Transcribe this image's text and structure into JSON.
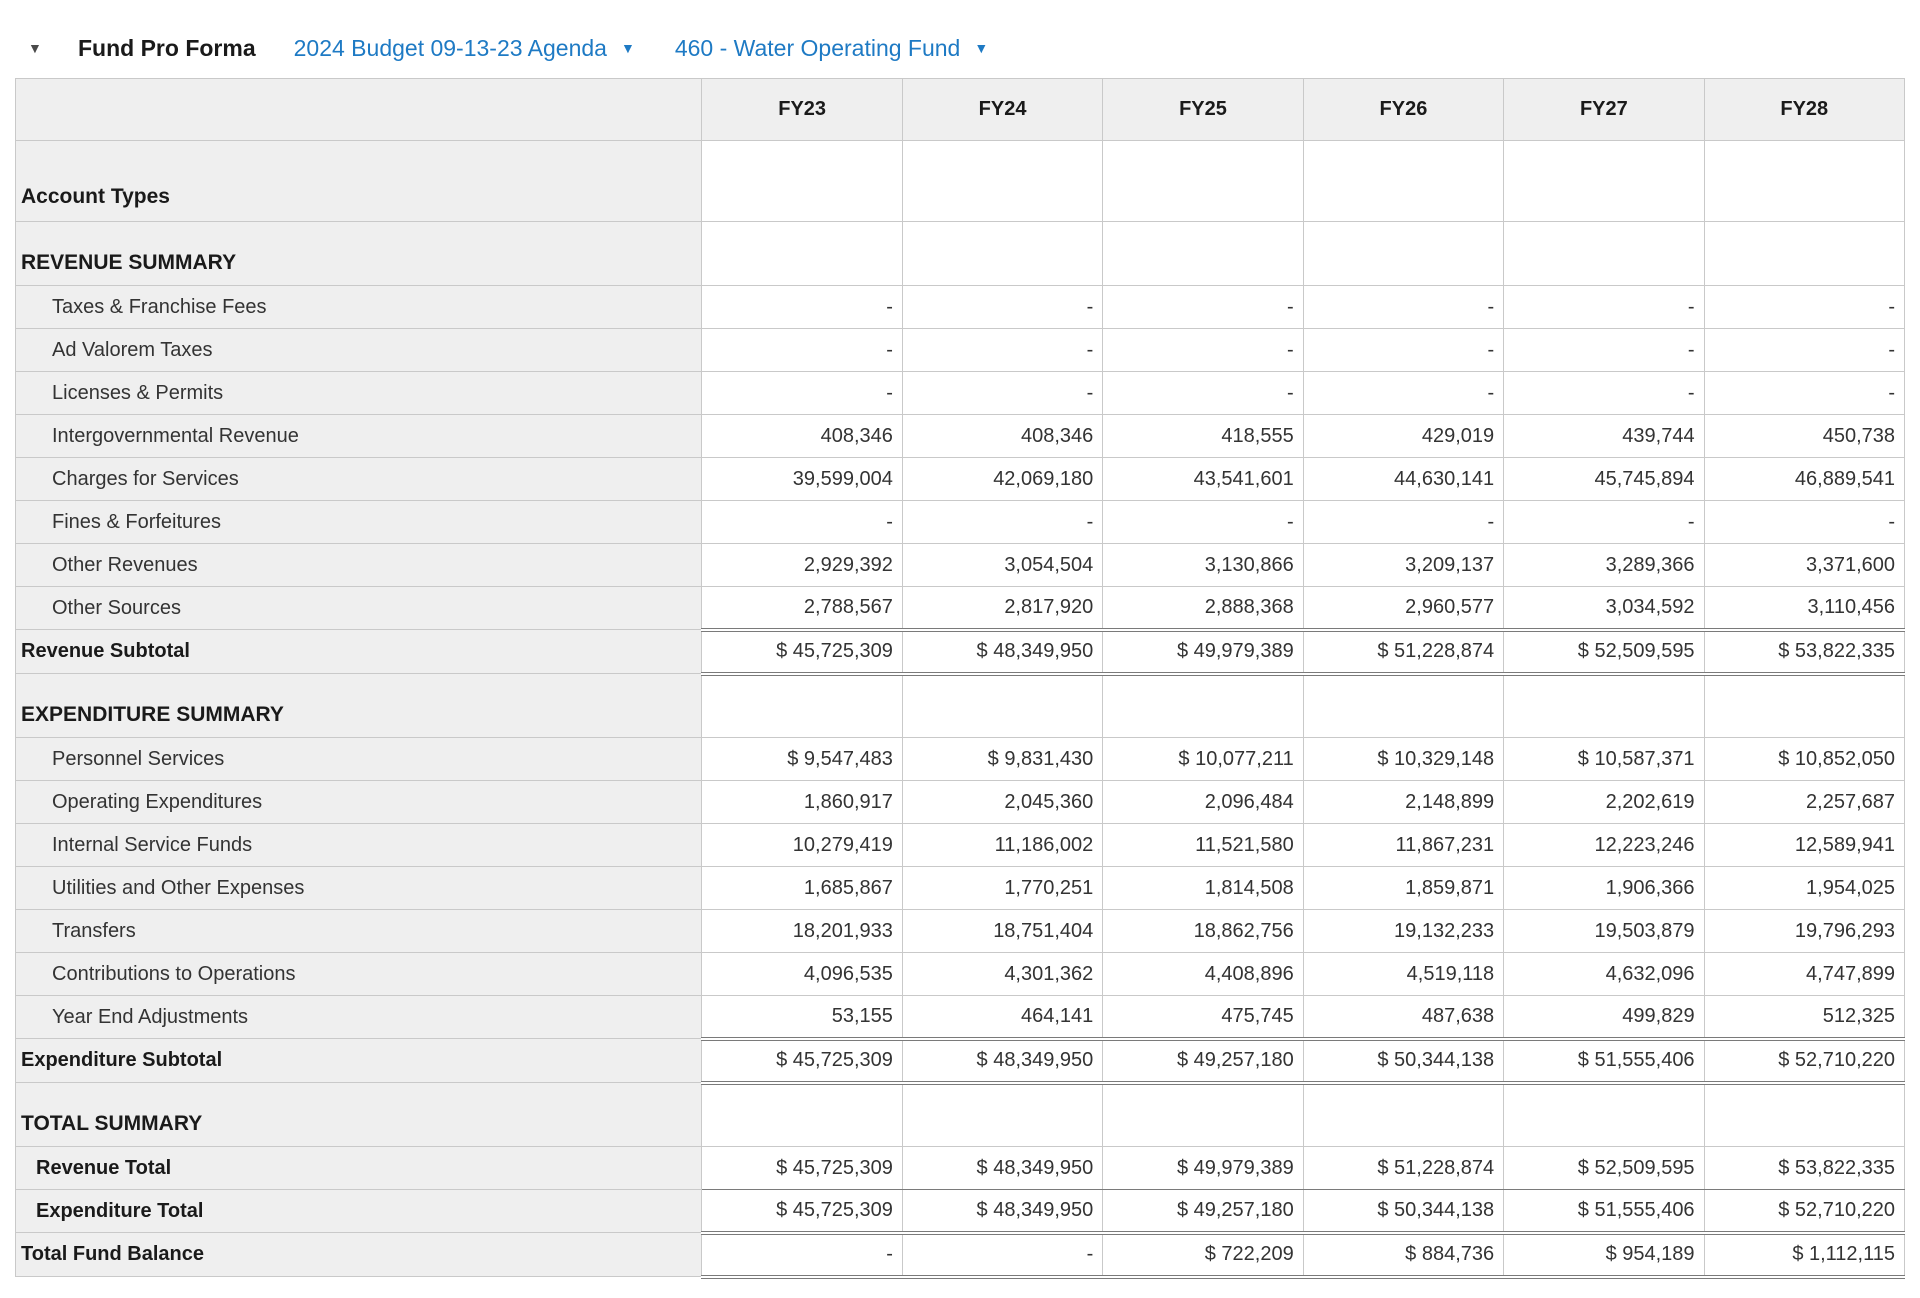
{
  "colors": {
    "link": "#1e7ac4",
    "shade": "#efefef",
    "border": "#c9c9c9",
    "rule": "#7a7a7a"
  },
  "header": {
    "title": "Fund Pro Forma",
    "budget_dropdown": "2024 Budget 09-13-23 Agenda",
    "fund_dropdown": "460 - Water Operating Fund",
    "collapse_caret": "▼",
    "dropdown_caret": "▼"
  },
  "table": {
    "columns": [
      "FY23",
      "FY24",
      "FY25",
      "FY26",
      "FY27",
      "FY28"
    ],
    "rows": [
      {
        "type": "caption",
        "label": "Account Types",
        "values": [
          "",
          "",
          "",
          "",
          "",
          ""
        ]
      },
      {
        "type": "section",
        "label": "REVENUE SUMMARY",
        "values": [
          "",
          "",
          "",
          "",
          "",
          ""
        ]
      },
      {
        "type": "item",
        "label": "Taxes & Franchise Fees",
        "values": [
          "-",
          "-",
          "-",
          "-",
          "-",
          "-"
        ]
      },
      {
        "type": "item",
        "label": "Ad Valorem Taxes",
        "values": [
          "-",
          "-",
          "-",
          "-",
          "-",
          "-"
        ]
      },
      {
        "type": "item",
        "label": "Licenses & Permits",
        "values": [
          "-",
          "-",
          "-",
          "-",
          "-",
          "-"
        ]
      },
      {
        "type": "item",
        "label": "Intergovernmental Revenue",
        "values": [
          "408,346",
          "408,346",
          "418,555",
          "429,019",
          "439,744",
          "450,738"
        ]
      },
      {
        "type": "item",
        "label": "Charges for Services",
        "values": [
          "39,599,004",
          "42,069,180",
          "43,541,601",
          "44,630,141",
          "45,745,894",
          "46,889,541"
        ]
      },
      {
        "type": "item",
        "label": "Fines & Forfeitures",
        "values": [
          "-",
          "-",
          "-",
          "-",
          "-",
          "-"
        ]
      },
      {
        "type": "item",
        "label": "Other Revenues",
        "values": [
          "2,929,392",
          "3,054,504",
          "3,130,866",
          "3,209,137",
          "3,289,366",
          "3,371,600"
        ]
      },
      {
        "type": "item",
        "label": "Other Sources",
        "values": [
          "2,788,567",
          "2,817,920",
          "2,888,368",
          "2,960,577",
          "3,034,592",
          "3,110,456"
        ]
      },
      {
        "type": "subtotal",
        "label": "Revenue Subtotal",
        "values": [
          "$ 45,725,309",
          "$ 48,349,950",
          "$ 49,979,389",
          "$ 51,228,874",
          "$ 52,509,595",
          "$ 53,822,335"
        ]
      },
      {
        "type": "section",
        "label": "EXPENDITURE SUMMARY",
        "values": [
          "",
          "",
          "",
          "",
          "",
          ""
        ]
      },
      {
        "type": "item",
        "label": "Personnel Services",
        "values": [
          "$ 9,547,483",
          "$ 9,831,430",
          "$ 10,077,211",
          "$ 10,329,148",
          "$ 10,587,371",
          "$ 10,852,050"
        ]
      },
      {
        "type": "item",
        "label": "Operating Expenditures",
        "values": [
          "1,860,917",
          "2,045,360",
          "2,096,484",
          "2,148,899",
          "2,202,619",
          "2,257,687"
        ]
      },
      {
        "type": "item",
        "label": "Internal Service Funds",
        "values": [
          "10,279,419",
          "11,186,002",
          "11,521,580",
          "11,867,231",
          "12,223,246",
          "12,589,941"
        ]
      },
      {
        "type": "item",
        "label": "Utilities and Other Expenses",
        "values": [
          "1,685,867",
          "1,770,251",
          "1,814,508",
          "1,859,871",
          "1,906,366",
          "1,954,025"
        ]
      },
      {
        "type": "item",
        "label": "Transfers",
        "values": [
          "18,201,933",
          "18,751,404",
          "18,862,756",
          "19,132,233",
          "19,503,879",
          "19,796,293"
        ]
      },
      {
        "type": "item",
        "label": "Contributions to Operations",
        "values": [
          "4,096,535",
          "4,301,362",
          "4,408,896",
          "4,519,118",
          "4,632,096",
          "4,747,899"
        ]
      },
      {
        "type": "item",
        "label": "Year End Adjustments",
        "values": [
          "53,155",
          "464,141",
          "475,745",
          "487,638",
          "499,829",
          "512,325"
        ]
      },
      {
        "type": "subtotal",
        "label": "Expenditure Subtotal",
        "values": [
          "$ 45,725,309",
          "$ 48,349,950",
          "$ 49,257,180",
          "$ 50,344,138",
          "$ 51,555,406",
          "$ 52,710,220"
        ]
      },
      {
        "type": "section",
        "label": "TOTAL SUMMARY",
        "values": [
          "",
          "",
          "",
          "",
          "",
          ""
        ]
      },
      {
        "type": "total",
        "rule": "single",
        "label": "Revenue Total",
        "values": [
          "$ 45,725,309",
          "$ 48,349,950",
          "$ 49,979,389",
          "$ 51,228,874",
          "$ 52,509,595",
          "$ 53,822,335"
        ]
      },
      {
        "type": "total",
        "rule": "double",
        "label": "Expenditure Total",
        "values": [
          "$ 45,725,309",
          "$ 48,349,950",
          "$ 49,257,180",
          "$ 50,344,138",
          "$ 51,555,406",
          "$ 52,710,220"
        ]
      },
      {
        "type": "balance",
        "label": "Total Fund Balance",
        "values": [
          "-",
          "-",
          "$ 722,209",
          "$ 884,736",
          "$ 954,189",
          "$ 1,112,115"
        ]
      }
    ]
  }
}
